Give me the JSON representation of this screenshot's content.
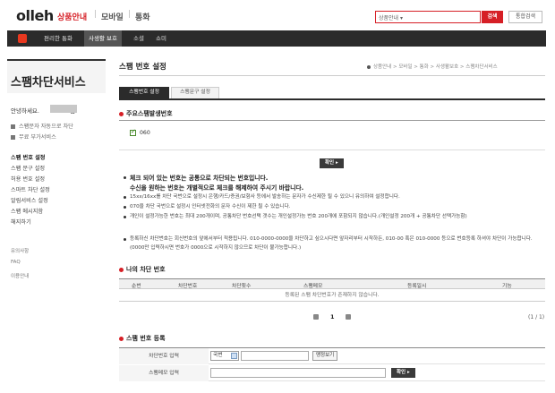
{
  "header": {
    "logo": "olleh",
    "gnb": [
      "상품안내",
      "모바일",
      "통화"
    ],
    "search_select": "상품안내",
    "search_button": "검색",
    "total_search_button": "통합검색"
  },
  "subnav": {
    "items": [
      "편리한 통화",
      "사생활 보호",
      "소셜",
      "쇼미"
    ],
    "active_index": 1
  },
  "sidebar": {
    "title": "스팸차단서비스",
    "greeting": "안녕하세요.",
    "greeting_suffix": "님",
    "links": [
      "스팸문자 자동으로 차단",
      "무료 부가서비스"
    ],
    "menu": [
      "스팸 번호 설정",
      "스팸 문구 설정",
      "허용 번호 설정",
      "스마트 차단 설정",
      "알림서비스 설정",
      "스팸 메시지함",
      "해지하기"
    ],
    "bottom": [
      "유의사항",
      "FAQ",
      "이용안내"
    ]
  },
  "main": {
    "title": "스팸 번호 설정",
    "breadcrumb": "상품안내 > 모바일 > 통화 > 사생활보호 > 스팸차단서비스",
    "tabs": [
      "스팸번호 설정",
      "스팸문구 설정"
    ],
    "section_major": "주요스팸발생번호",
    "checkbox_label": "060",
    "confirm_button": "확인 ▸",
    "notice_bold_1": "체크 되어 있는 번호는 공통으로 차단되는 번호입니다.",
    "notice_bold_2": "수신을 원하는 번호는 개별적으로 체크를 해제하여 주시기 바랍니다.",
    "notices": [
      "15xx/16xx를 차단 국번으로 설정시 은행/카드/증권/보험사 등에서 발송하는 문자가 수신제한 될 수 있으니 유의하여 설정합니다.",
      "070을 차단 국번으로 설정시 인터넷전화의 문자 수신이 제한 될 수 있습니다.",
      "개인이 설정가능한 번호는 최대 200개이며, 공통차단 번호선택 갯수는 개인설정가능 번호 200개에 포함되지 않습니다.(개인설정 200개 + 공통차단 선택가능함)",
      "등록하신 차단번호는 회신번호의 앞에서부터 적용됩니다. 010-0000-0000을 차단하고 싶으시다면 앞자리부터 시작하든, 010-00 혹은 010-0000 등으로 번호등록 하셔야 차단이 가능합니다.(0000만 입력하시면 번호가 0000으로 시작하지 않으므로 차단이 불가능합니다.)"
    ],
    "section_my": "나의 차단 번호",
    "table_headers": [
      "순번",
      "차단번호",
      "차단횟수",
      "스팸메모",
      "등록일시",
      "기능"
    ],
    "table_empty": "등록된 스팸 차단번호가 존재하지 않습니다.",
    "page_current": "1",
    "page_count": "(1 / 1)",
    "section_register": "스팸 번호 등록",
    "reg_label_number": "차단번호 입력",
    "reg_label_memo": "스팸메모 입력",
    "country_select": "국번",
    "lookup_button": "맹정보기",
    "reg_confirm_button": "확인 ▸"
  },
  "colors": {
    "brand": "#d61f26",
    "dark": "#2b2b2b"
  }
}
